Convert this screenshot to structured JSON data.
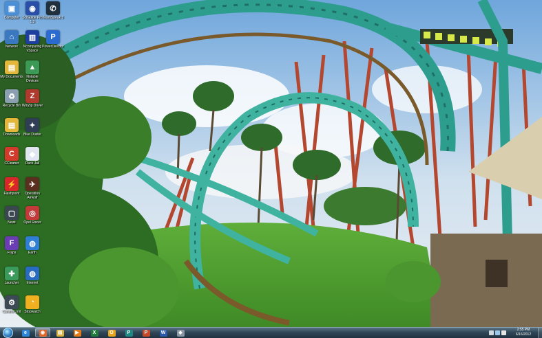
{
  "desktop_icons": [
    {
      "label": "Computer",
      "icon": "computer-icon",
      "color": "#4b8fd6",
      "glyph": "▣"
    },
    {
      "label": "SciGuide Pro 1.3",
      "icon": "sciguide-icon",
      "color": "#2a4fa8",
      "glyph": "◉"
    },
    {
      "label": "TeamSpeak 3",
      "icon": "teamspeak-icon",
      "color": "#20303d",
      "glyph": "✆"
    },
    {
      "label": "Network",
      "icon": "network-icon",
      "color": "#3a78c0",
      "glyph": "⌂"
    },
    {
      "label": "Ncomputing vSpace",
      "icon": "ncomputing-icon",
      "color": "#1d3fa0",
      "glyph": "▥"
    },
    {
      "label": "PowerDirector",
      "icon": "powerdirector-icon",
      "color": "#2b6bd0",
      "glyph": "P"
    },
    {
      "label": "My Documents",
      "icon": "folder-icon",
      "color": "#e3b63c",
      "glyph": "▤"
    },
    {
      "label": "Notable Devices",
      "icon": "notable-icon",
      "color": "#3c9a56",
      "glyph": "▲"
    },
    {
      "label": "Recycle Bin",
      "icon": "recycle-bin-icon",
      "color": "#8aa0b0",
      "glyph": "♻"
    },
    {
      "label": "WinZip Driver",
      "icon": "winzip-icon",
      "color": "#b03a2e",
      "glyph": "Z"
    },
    {
      "label": "Downloads",
      "icon": "downloads-folder-icon",
      "color": "#e3b63c",
      "glyph": "▤"
    },
    {
      "label": "Blue Duster",
      "icon": "blue-duster-icon",
      "color": "#2f3d55",
      "glyph": "✦"
    },
    {
      "label": "CCleaner",
      "icon": "ccleaner-icon",
      "color": "#d23b2c",
      "glyph": "C"
    },
    {
      "label": "Duck Jail",
      "icon": "duck-jail-icon",
      "color": "#dfe6ef",
      "glyph": "◆"
    },
    {
      "label": "Flashpoint",
      "icon": "flashpoint-icon",
      "color": "#d8262a",
      "glyph": "⚡"
    },
    {
      "label": "Operation Airwolf",
      "icon": "airwolf-icon",
      "color": "#5a2f20",
      "glyph": "✈"
    },
    {
      "label": "Newt",
      "icon": "newt-icon",
      "color": "#3a4650",
      "glyph": "▢"
    },
    {
      "label": "Opel Racer",
      "icon": "opel-racer-icon",
      "color": "#c23a3a",
      "glyph": "◎"
    },
    {
      "label": "Fraps",
      "icon": "fraps-icon",
      "color": "#6a3db3",
      "glyph": "F"
    },
    {
      "label": "Earth",
      "icon": "earth-icon",
      "color": "#2f7fd6",
      "glyph": "◍"
    },
    {
      "label": "Launcher",
      "icon": "launcher-icon",
      "color": "#3a9a5c",
      "glyph": "✚"
    },
    {
      "label": "Internet",
      "icon": "globe-icon",
      "color": "#2a6bc2",
      "glyph": "◍"
    },
    {
      "label": "Control Unit",
      "icon": "control-unit-icon",
      "color": "#3d4a56",
      "glyph": "⚙"
    },
    {
      "label": "Stopwatch",
      "icon": "stopwatch-icon",
      "color": "#f0b020",
      "glyph": "◔"
    }
  ],
  "taskbar": {
    "pinned": [
      {
        "name": "internet-explorer-icon",
        "color": "#2f84d8",
        "glyph": "e"
      },
      {
        "name": "firefox-icon",
        "color": "#e0652a",
        "glyph": "◉"
      },
      {
        "name": "explorer-folder-icon",
        "color": "#d9b13c",
        "glyph": "▤"
      },
      {
        "name": "media-player-icon",
        "color": "#e07a1a",
        "glyph": "▶"
      },
      {
        "name": "excel-icon",
        "color": "#1f7a3c",
        "glyph": "X"
      },
      {
        "name": "outlook-icon",
        "color": "#e5a51c",
        "glyph": "O"
      },
      {
        "name": "publisher-icon",
        "color": "#1f8a84",
        "glyph": "P"
      },
      {
        "name": "powerpoint-icon",
        "color": "#c8482a",
        "glyph": "P"
      },
      {
        "name": "word-icon",
        "color": "#2b5aa8",
        "glyph": "W"
      },
      {
        "name": "app-icon",
        "color": "#8a96a2",
        "glyph": "◆"
      }
    ],
    "clock": {
      "time": "2:55 PM",
      "date": "6/16/2012"
    }
  }
}
